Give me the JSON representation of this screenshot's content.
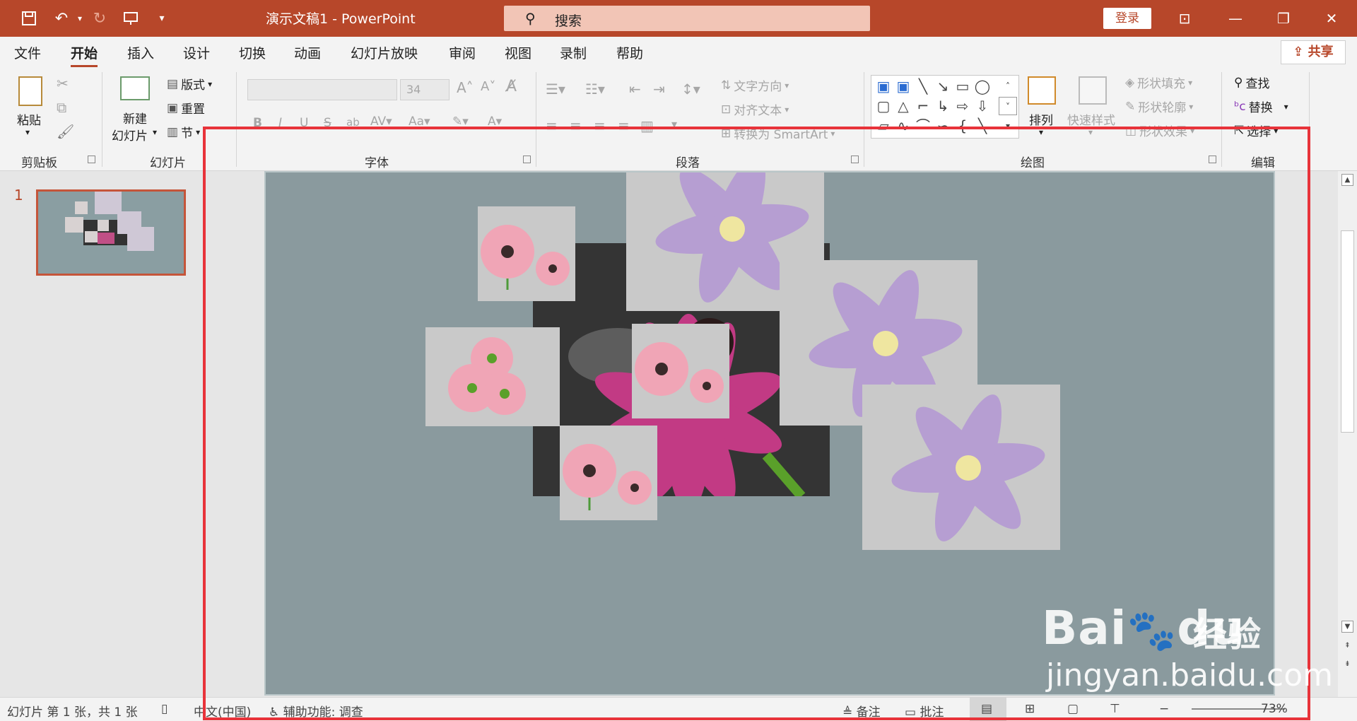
{
  "titlebar": {
    "doc_title": "演示文稿1  -  PowerPoint",
    "search_placeholder": "搜索",
    "login_label": "登录",
    "color": "#b7472a"
  },
  "menu": {
    "tabs": [
      "文件",
      "开始",
      "插入",
      "设计",
      "切换",
      "动画",
      "幻灯片放映",
      "审阅",
      "视图",
      "录制",
      "帮助"
    ],
    "active_tab": "开始",
    "share_label": "共享"
  },
  "ribbon": {
    "clipboard": {
      "paste_label": "粘贴",
      "group_label": "剪贴板"
    },
    "slides": {
      "new_slide_line1": "新建",
      "new_slide_line2": "幻灯片",
      "layout_label": "版式",
      "reset_label": "重置",
      "section_label": "节",
      "group_label": "幻灯片"
    },
    "font": {
      "font_size": "34",
      "group_label": "字体"
    },
    "paragraph": {
      "text_direction_label": "文字方向",
      "align_text_label": "对齐文本",
      "smartart_label": "转换为 SmartArt",
      "group_label": "段落"
    },
    "drawing": {
      "arrange_label": "排列",
      "quick_styles_label": "快速样式",
      "shape_fill_label": "形状填充",
      "shape_outline_label": "形状轮廓",
      "shape_effects_label": "形状效果",
      "group_label": "绘图"
    },
    "editing": {
      "find_label": "查找",
      "replace_label": "替换",
      "select_label": "选择",
      "group_label": "编辑"
    }
  },
  "thumbs": {
    "slide_number": "1"
  },
  "watermark": {
    "brand": "Bai",
    "brand2": "du",
    "brand_cn": "经验",
    "url": "jingyan.baidu.com"
  },
  "status": {
    "slide_info": "幻灯片 第 1 张，共 1 张",
    "language": "中文(中国)",
    "accessibility": "辅助功能: 调查",
    "notes_label": "备注",
    "comments_label": "批注",
    "zoom": "73%"
  },
  "colors": {
    "accent": "#b7472a",
    "annotation": "#e8333a"
  }
}
